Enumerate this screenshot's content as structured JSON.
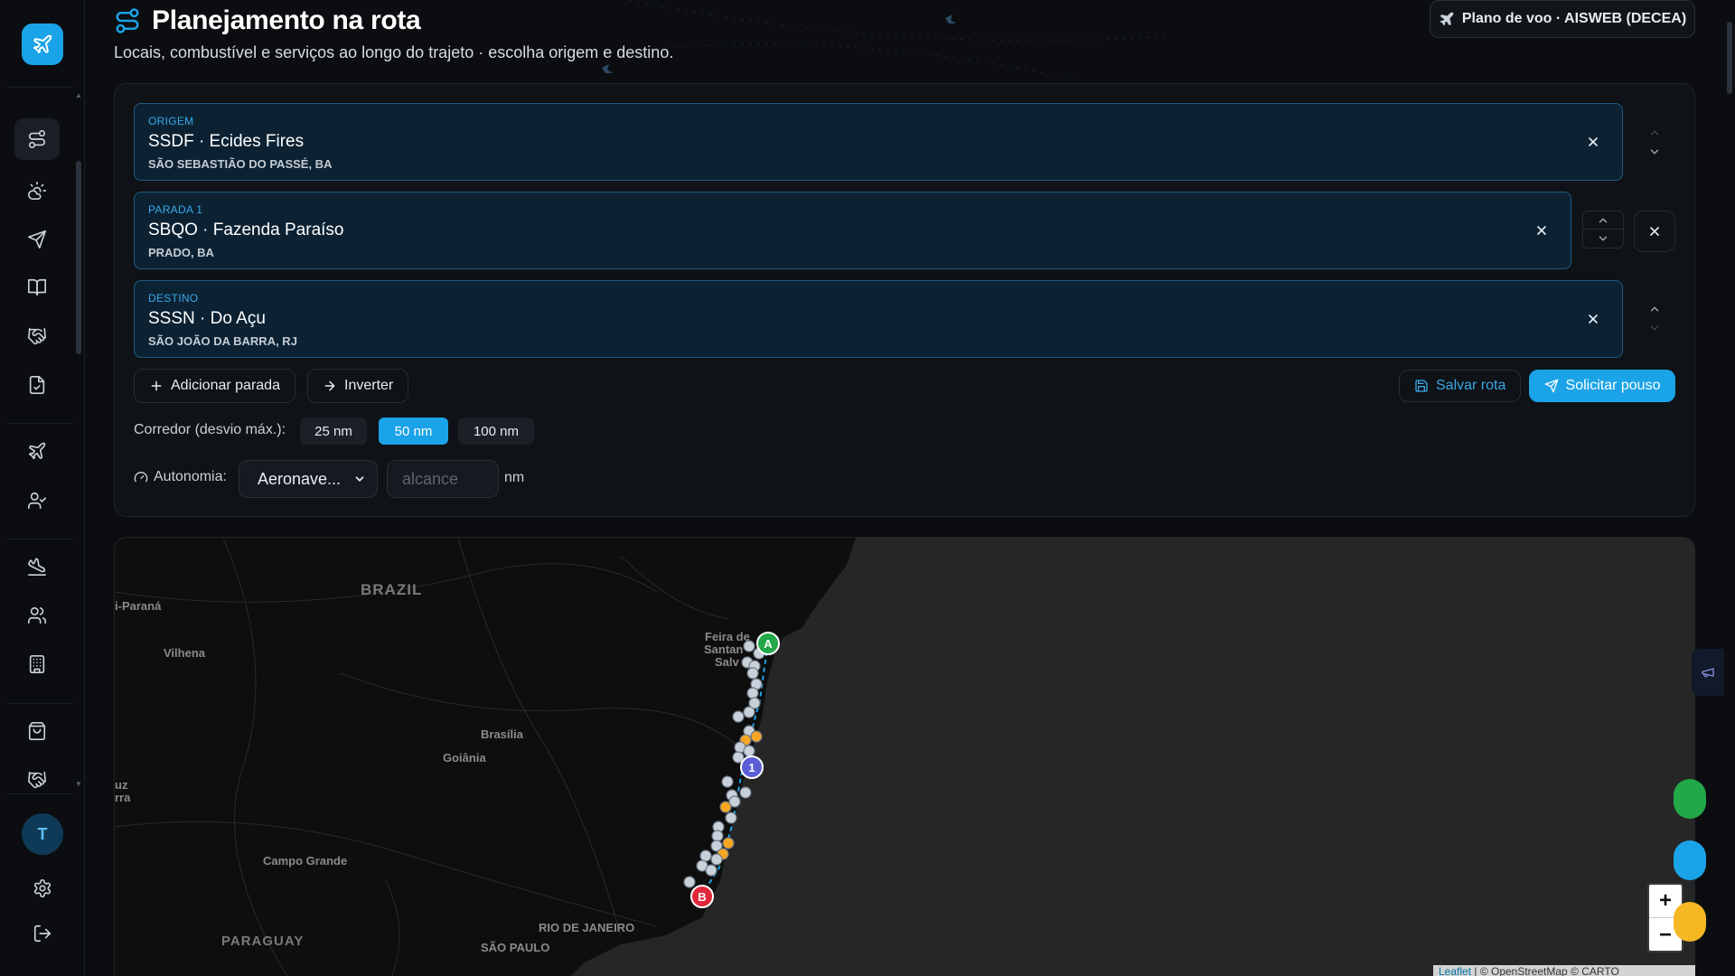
{
  "header": {
    "title": "Planejamento na rota",
    "subtitle": "Locais, combustível e serviços ao longo do trajeto · escolha origem e destino.",
    "flight_plan_button": "Plano de voo · AISWEB (DECEA)"
  },
  "sidebar": {
    "avatar_initial": "T",
    "items": [
      "route-planning",
      "weather",
      "send",
      "book",
      "handshake",
      "document",
      "aircraft",
      "pilot",
      "landing",
      "users",
      "building",
      "bag",
      "handshake-2"
    ]
  },
  "route": {
    "stops": [
      {
        "label": "ORIGEM",
        "name": "SSDF · Ecides Fires",
        "city": "SÃO SEBASTIÃO DO PASSÉ, BA"
      },
      {
        "label": "PARADA 1",
        "name": "SBQO · Fazenda Paraíso",
        "city": "PRADO, BA"
      },
      {
        "label": "DESTINO",
        "name": "SSSN · Do Açu",
        "city": "SÃO JOÃO DA BARRA, RJ"
      }
    ],
    "add_stop_label": "Adicionar parada",
    "invert_label": "Inverter",
    "save_route_label": "Salvar rota",
    "request_landing_label": "Solicitar pouso",
    "corridor_label": "Corredor (desvio máx.):",
    "corridor_options": [
      "25 nm",
      "50 nm",
      "100 nm"
    ],
    "corridor_selected": "50 nm",
    "autonomy_label": "Autonomia:",
    "aircraft_select_value": "Aeronave...",
    "range_placeholder": "alcance",
    "range_unit": "nm"
  },
  "map": {
    "labels": {
      "brazil": "BRAZIL",
      "parana": "i-Paraná",
      "vilhena": "Vilhena",
      "feira": "Feira de",
      "santana": "Santan",
      "salvador": "Salv",
      "brasilia": "Brasília",
      "goiania": "Goiânia",
      "cuz": "uz",
      "rra": "rra",
      "campo_grande": "Campo Grande",
      "paraguay": "PARAGUAY",
      "rio": "RIO DE JANEIRO",
      "sao_paulo": "SÃO PAULO"
    },
    "markers": {
      "origin": "A",
      "stop": "1",
      "destination": "B"
    },
    "zoom_in": "+",
    "zoom_out": "−",
    "attribution_leaflet": "Leaflet",
    "attribution_rest": " | © OpenStreetMap © CARTO"
  },
  "colors": {
    "accent": "#1ba3e8",
    "origin_marker": "#22a848",
    "stop_marker": "#5b5fd6",
    "destination_marker": "#e0283a",
    "fuel_point": "#f5a623",
    "place_point": "#c8d0da"
  }
}
